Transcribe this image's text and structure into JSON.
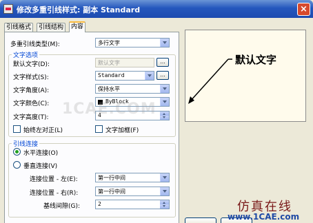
{
  "window": {
    "title": "修改多重引线样式: 副本 Standard",
    "close_glyph": "×"
  },
  "tabs": [
    {
      "label": "引线格式"
    },
    {
      "label": "引线结构"
    },
    {
      "label": "内容"
    }
  ],
  "content": {
    "multileader_type": {
      "label": "多重引线类型(M):",
      "value": "多行文字"
    },
    "text_options": {
      "title": "文字选项",
      "default_text": {
        "label": "默认文字(D):",
        "value": "默认文字",
        "button": "..."
      },
      "text_style": {
        "label": "文字样式(S):",
        "value": "Standard",
        "button": "..."
      },
      "text_angle": {
        "label": "文字角度(A):",
        "value": "保持水平"
      },
      "text_color": {
        "label": "文字颜色(C):",
        "value": "ByBlock",
        "swatch_color": "#000000"
      },
      "text_height": {
        "label": "文字高度(T):",
        "value": "4"
      },
      "always_left_justify": {
        "label": "始终左对正(L)",
        "checked": false
      },
      "text_frame": {
        "label": "文字加框(F)",
        "checked": false
      }
    },
    "leader_connection": {
      "title": "引线连接",
      "horizontal": {
        "label": "水平连接(O)",
        "selected": true
      },
      "vertical": {
        "label": "垂直连接(V)",
        "selected": false
      },
      "attach_left": {
        "label": "连接位置 - 左(E):",
        "value": "第一行中间"
      },
      "attach_right": {
        "label": "连接位置 - 右(R):",
        "value": "第一行中间"
      },
      "landing_gap": {
        "label": "基线间隙(G):",
        "value": "2"
      }
    }
  },
  "preview": {
    "text": "默认文字"
  },
  "watermarks": {
    "center": "1CAE.COM",
    "brand": "仿真在线",
    "url": "www.1CAE.com"
  },
  "colors": {
    "title_bar": "#2557bd",
    "group_title": "#0046d5",
    "preview_bg": "#fffbec",
    "radio_dot": "#21a121"
  }
}
